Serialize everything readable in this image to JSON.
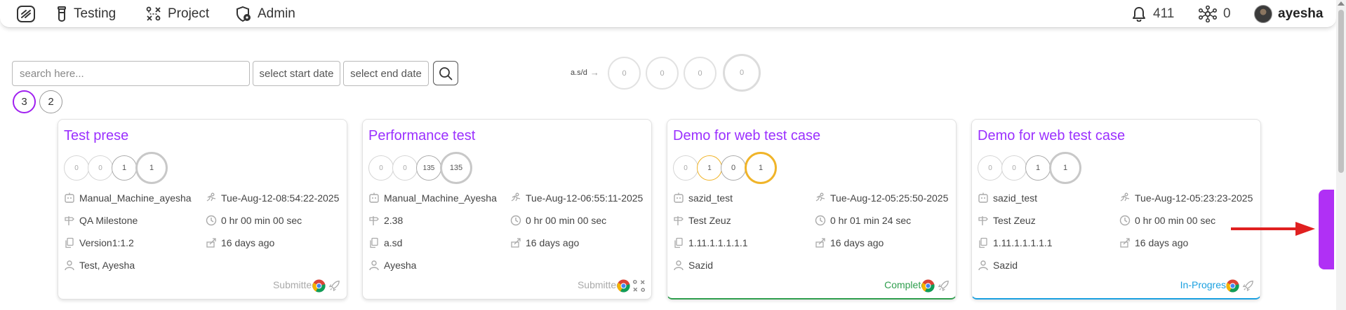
{
  "nav": {
    "testing_label": "Testing",
    "project_label": "Project",
    "admin_label": "Admin",
    "notification_count": "411",
    "network_count": "0",
    "username": "ayesha"
  },
  "filters": {
    "search_placeholder": "search here...",
    "start_date_label": "select start date",
    "end_date_label": "select end date"
  },
  "stats": {
    "label": "a.s/d",
    "arrow": "→",
    "values": [
      "0",
      "0",
      "0",
      "0"
    ]
  },
  "pagination": [
    "3",
    "2"
  ],
  "cards": [
    {
      "title": "Test prese",
      "counts": [
        "0",
        "0",
        "1",
        "1"
      ],
      "owner": "Manual_Machine_ayesha",
      "timestamp": "Tue-Aug-12-08:54:22-2025",
      "milestone": "QA Milestone",
      "duration": "0 hr 00 min 00 sec",
      "version": "Version1:1.2",
      "age": "16 days ago",
      "assignee": "Test, Ayesha",
      "status": "Submitted"
    },
    {
      "title": "Performance test",
      "counts": [
        "0",
        "0",
        "135",
        "135"
      ],
      "owner": "Manual_Machine_Ayesha",
      "timestamp": "Tue-Aug-12-06:55:11-2025",
      "milestone": "2.38",
      "duration": "0 hr 00 min 00 sec",
      "version": "a.sd",
      "age": "16 days ago",
      "assignee": "Ayesha",
      "status": "Submitted"
    },
    {
      "title": "Demo for web test case",
      "counts": [
        "0",
        "1",
        "0",
        "1"
      ],
      "owner": "sazid_test",
      "timestamp": "Tue-Aug-12-05:25:50-2025",
      "milestone": "Test Zeuz",
      "duration": "0 hr 01 min 24 sec",
      "version": "1.11.1.1.1.1.1",
      "age": "16 days ago",
      "assignee": "Sazid",
      "status": "Complete"
    },
    {
      "title": "Demo for web test case",
      "counts": [
        "0",
        "0",
        "1",
        "1"
      ],
      "owner": "sazid_test",
      "timestamp": "Tue-Aug-12-05:23:23-2025",
      "milestone": "Test Zeuz",
      "duration": "0 hr 00 min 00 sec",
      "version": "1.11.1.1.1.1.1",
      "age": "16 days ago",
      "assignee": "Sazid",
      "status": "In-Progress"
    }
  ],
  "colors": {
    "accent": "#9b30ff",
    "complete": "#2e9e4d",
    "in_progress": "#1aa0e0",
    "warning_ring": "#f0b429",
    "arrow": "#e02020"
  }
}
